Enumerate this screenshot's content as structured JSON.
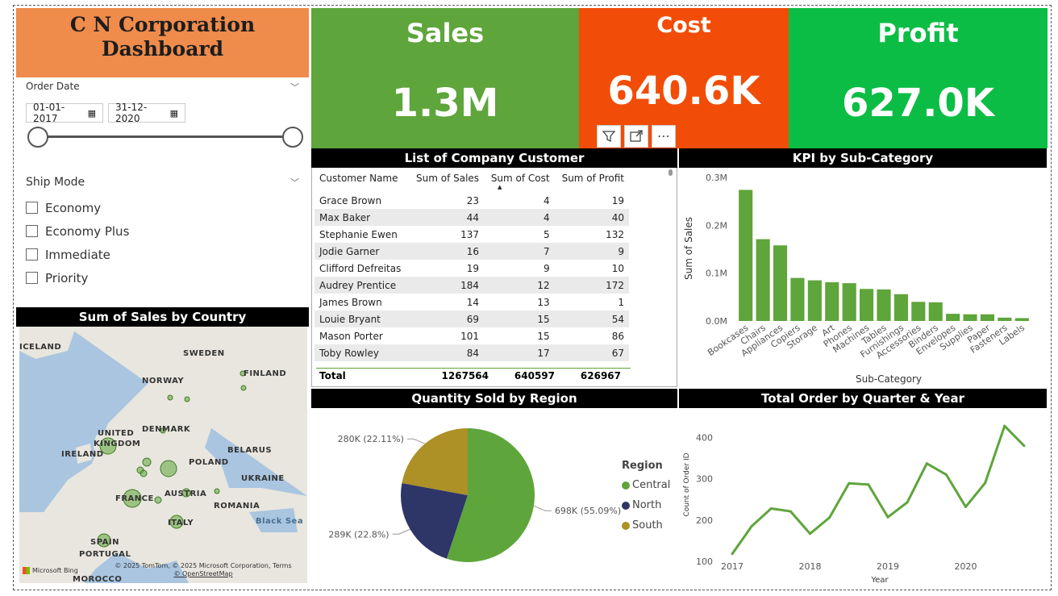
{
  "header": {
    "title_line1": "C N Corporation",
    "title_line2": "Dashboard"
  },
  "kpis": [
    {
      "label": "Sales",
      "value": "1.3M",
      "color": "#5ea53b"
    },
    {
      "label": "Cost",
      "value": "640.6K",
      "color": "#f14d08"
    },
    {
      "label": "Profit",
      "value": "627.0K",
      "color": "#0bbd45"
    }
  ],
  "order_date": {
    "title": "Order Date",
    "start": "01-01-2017",
    "end": "31-12-2020"
  },
  "ship_mode": {
    "title": "Ship Mode",
    "options": [
      "Economy",
      "Economy Plus",
      "Immediate",
      "Priority"
    ]
  },
  "map": {
    "title": "Sum of Sales by Country",
    "labels": [
      "ICELAND",
      "SWEDEN",
      "FINLAND",
      "NORWAY",
      "UNITED",
      "KINGDOM",
      "DENMARK",
      "IRELAND",
      "BELARUS",
      "POLAND",
      "UKRAINE",
      "FRANCE",
      "AUSTRIA",
      "ROMANIA",
      "ITALY",
      "Black Sea",
      "SPAIN",
      "PORTUGAL",
      "MOROCCO"
    ],
    "attribution": "© 2025 TomTom, © 2025 Microsoft Corporation, Terms",
    "osm": "© OpenStreetMap",
    "bing": "Microsoft Bing"
  },
  "customer_table": {
    "title": "List of Company Customer",
    "columns": [
      "Customer Name",
      "Sum of Sales",
      "Sum of Cost",
      "Sum of Profit"
    ],
    "rows": [
      [
        "Grace Brown",
        "23",
        "4",
        "19"
      ],
      [
        "Max Baker",
        "44",
        "4",
        "40"
      ],
      [
        "Stephanie Ewen",
        "137",
        "5",
        "132"
      ],
      [
        "Jodie Garner",
        "16",
        "7",
        "9"
      ],
      [
        "Clifford Defreitas",
        "19",
        "9",
        "10"
      ],
      [
        "Audrey Prentice",
        "184",
        "12",
        "172"
      ],
      [
        "James Brown",
        "14",
        "13",
        "1"
      ],
      [
        "Louie Bryant",
        "69",
        "15",
        "54"
      ],
      [
        "Mason Porter",
        "101",
        "15",
        "86"
      ],
      [
        "Toby Rowley",
        "84",
        "17",
        "67"
      ]
    ],
    "total": [
      "Total",
      "1267564",
      "640597",
      "626967"
    ]
  },
  "chart_data": [
    {
      "type": "bar",
      "title": "KPI by Sub-Category",
      "xlabel": "Sub-Category",
      "ylabel": "Sum of Sales",
      "ylim": [
        0,
        300000
      ],
      "yticks": [
        "0.0M",
        "0.1M",
        "0.2M",
        "0.3M"
      ],
      "categories": [
        "Bookcases",
        "Chairs",
        "Appliances",
        "Copiers",
        "Storage",
        "Art",
        "Phones",
        "Machines",
        "Tables",
        "Furnishings",
        "Accessories",
        "Binders",
        "Envelopes",
        "Supplies",
        "Paper",
        "Fasteners",
        "Labels"
      ],
      "values": [
        274000,
        171000,
        158000,
        90000,
        85000,
        81000,
        79000,
        67000,
        66000,
        56000,
        40000,
        39000,
        15000,
        14000,
        14000,
        7000,
        6000
      ],
      "color": "#5ea53b"
    },
    {
      "type": "pie",
      "title": "Quantity Sold by Region",
      "legend_title": "Region",
      "categories": [
        "Central",
        "North",
        "South"
      ],
      "values": [
        698000,
        289000,
        280000
      ],
      "labels": [
        "698K (55.09%)",
        "289K (22.8%)",
        "280K (22.11%)"
      ],
      "colors": [
        "#5ea53b",
        "#2e3668",
        "#ad9026"
      ]
    },
    {
      "type": "line",
      "title": "Total Order by Quarter & Year",
      "xlabel": "Year",
      "ylabel": "Count of Order ID",
      "xticks": [
        "2017",
        "2018",
        "2019",
        "2020"
      ],
      "yticks": [
        "100",
        "200",
        "300",
        "400"
      ],
      "ylim": [
        100,
        440
      ],
      "x": [
        "2017 Q1",
        "2017 Q2",
        "2017 Q3",
        "2017 Q4",
        "2018 Q1",
        "2018 Q2",
        "2018 Q3",
        "2018 Q4",
        "2019 Q1",
        "2019 Q2",
        "2019 Q3",
        "2019 Q4",
        "2020 Q1",
        "2020 Q2",
        "2020 Q3",
        "2020 Q4"
      ],
      "values": [
        118,
        185,
        228,
        221,
        167,
        206,
        289,
        286,
        207,
        243,
        337,
        310,
        232,
        290,
        428,
        380
      ],
      "color": "#5ea53b"
    }
  ]
}
